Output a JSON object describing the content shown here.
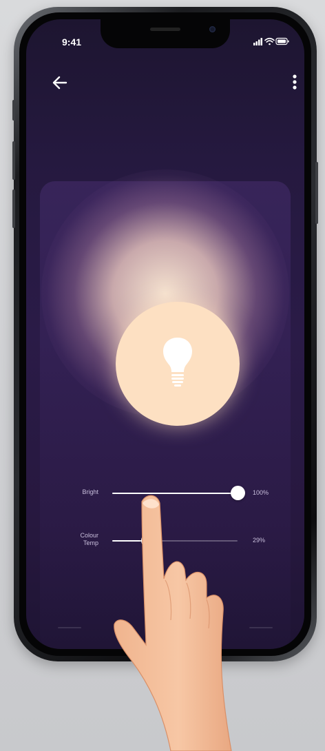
{
  "status_bar": {
    "time": "9:41",
    "icons": [
      "signal-icon",
      "wifi-icon",
      "battery-icon"
    ]
  },
  "app_bar": {
    "back_icon": "arrow-left-icon",
    "menu_icon": "more-vertical-icon"
  },
  "lamp": {
    "icon": "lightbulb-icon",
    "color": "#fde0c2"
  },
  "controls": {
    "brightness": {
      "label": "Bright",
      "value_text": "100%",
      "value": 1.0
    },
    "colour_temp": {
      "label_line1": "Colour",
      "label_line2": "Temp",
      "value_text": "29%",
      "value": 0.29
    }
  },
  "colors": {
    "background_top": "#1d1530",
    "background_mid": "#2a1b47",
    "accent": "#ffffff",
    "label_text": "#c9bfdc",
    "lamp_glow": "#fde0c2"
  }
}
